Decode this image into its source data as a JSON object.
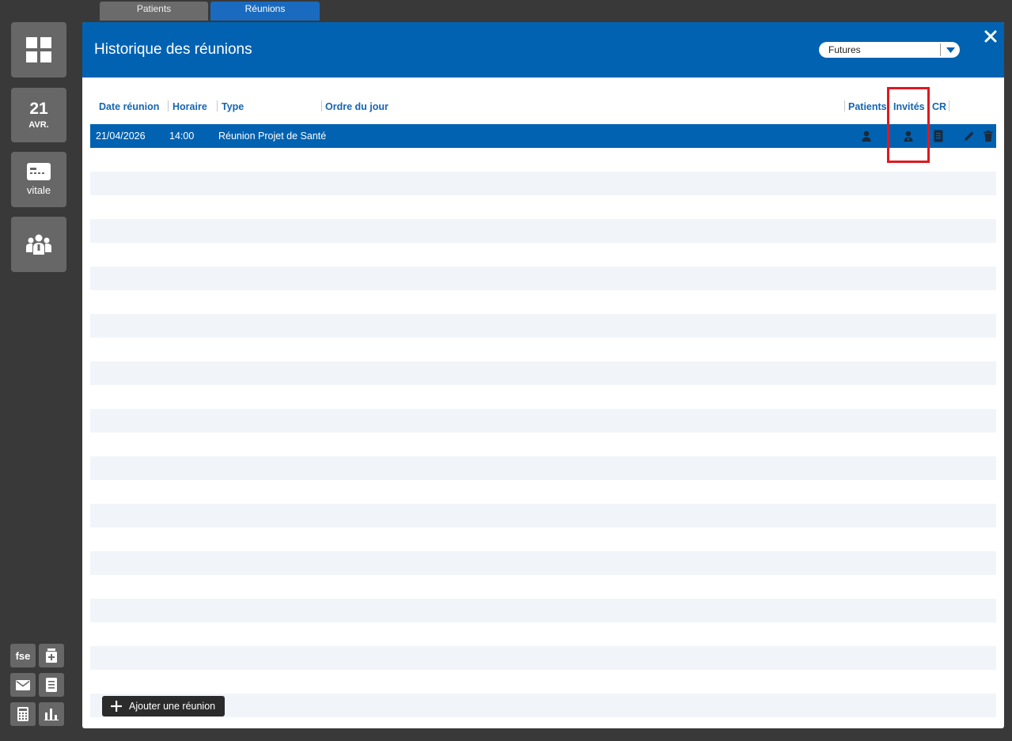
{
  "top_tabs": [
    {
      "label": "Patients",
      "active": false
    },
    {
      "label": "Réunions",
      "active": true
    }
  ],
  "sidebar": {
    "dashboard_icon": "grid-icon",
    "date": {
      "day": "21",
      "month": "AVR."
    },
    "vitale": {
      "label": "vitale",
      "icon": "card-icon"
    },
    "group_icon": "group-icon",
    "bottom_tools": {
      "fse_label": "fse",
      "icons": [
        "medical-kit-icon",
        "mail-icon",
        "document-icon",
        "calculator-icon",
        "bar-chart-icon"
      ]
    }
  },
  "panel": {
    "title": "Historique des réunions",
    "filter": {
      "selected": "Futures"
    },
    "close_icon": "close-icon"
  },
  "table": {
    "headers": {
      "date": "Date réunion",
      "horaire": "Horaire",
      "type": "Type",
      "ordre": "Ordre du jour",
      "patients": "Patients",
      "invites": "Invités",
      "cr": "CR"
    },
    "rows": [
      {
        "date": "21/04/2026",
        "horaire": "14:00",
        "type": "Réunion Projet de Santé",
        "ordre": "",
        "icons": [
          "patient-icon",
          "invite-icon",
          "document-icon",
          "edit-icon",
          "delete-icon"
        ]
      }
    ]
  },
  "add_button": {
    "label": "Ajouter une réunion"
  },
  "colors": {
    "background": "#393939",
    "header_blue": "#0062b1",
    "header_text_blue": "#1565b0",
    "row_alt": "#f1f5f9",
    "highlight_red": "#e0181e",
    "sidebar_button": "#676767"
  }
}
